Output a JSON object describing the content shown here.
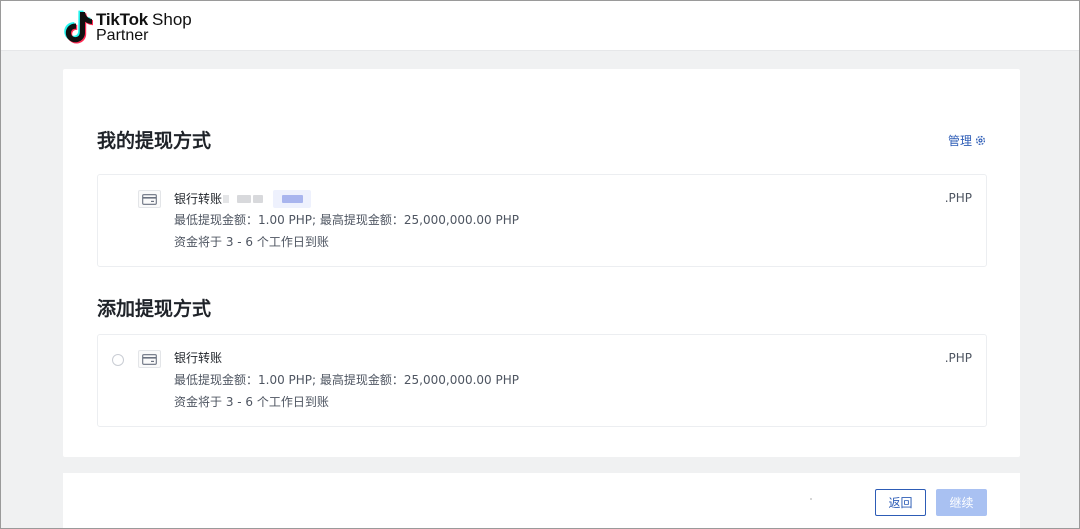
{
  "header": {
    "logo_brand": "TikTok",
    "logo_product": "Shop",
    "logo_sub": "Partner"
  },
  "saved_section": {
    "title": "我的提现方式",
    "manage_label": "管理",
    "method": {
      "name": "银行转账",
      "limits": "最低提现金额：1.00 PHP; 最高提现金额：25,000,000.00 PHP",
      "eta": "资金将于 3 - 6 个工作日到账",
      "currency": ".PHP"
    }
  },
  "add_section": {
    "title": "添加提现方式",
    "method": {
      "name": "银行转账",
      "limits": "最低提现金额：1.00 PHP; 最高提现金额：25,000,000.00 PHP",
      "eta": "资金将于 3 - 6 个工作日到账",
      "currency": ".PHP"
    }
  },
  "footer": {
    "back_label": "返回",
    "next_label": "继续"
  },
  "colors": {
    "accent": "#2d5cb6",
    "disabled_button": "#a9c1f2",
    "page_bg": "#f0f1f2"
  }
}
